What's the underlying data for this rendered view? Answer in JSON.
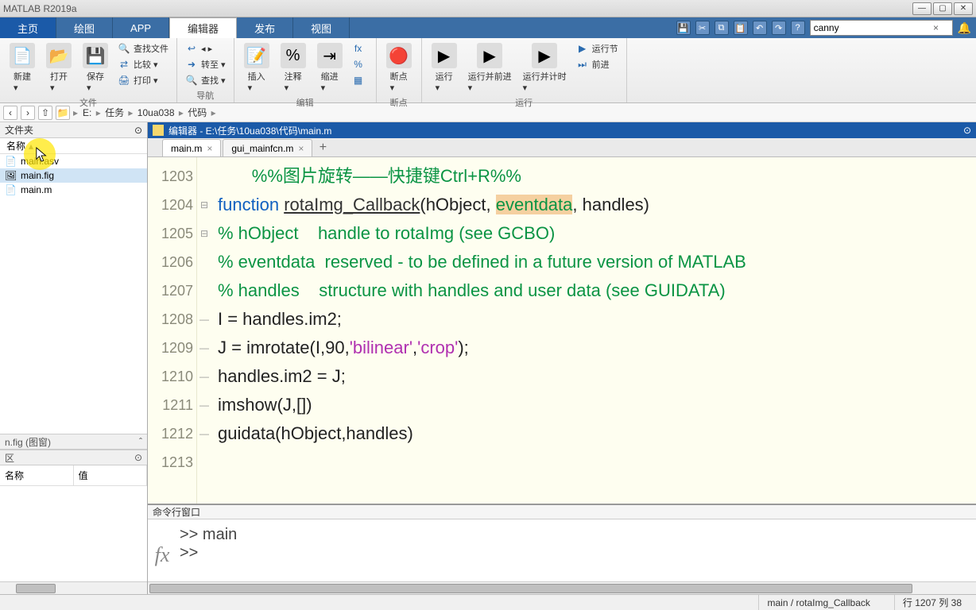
{
  "window": {
    "title": "MATLAB R2019a"
  },
  "tabs": {
    "items": [
      "主页",
      "绘图",
      "APP",
      "编辑器",
      "发布",
      "视图"
    ],
    "active_index": 3
  },
  "quick": {
    "search_value": "canny"
  },
  "ribbon": {
    "groups": [
      {
        "label": "文件",
        "big": [
          {
            "icon": "📄",
            "label": "新建"
          },
          {
            "icon": "📂",
            "label": "打开"
          },
          {
            "icon": "💾",
            "label": "保存"
          }
        ],
        "small": [
          {
            "icon": "🔍",
            "label": "查找文件"
          },
          {
            "icon": "⇄",
            "label": "比较 ▾"
          },
          {
            "icon": "🖨",
            "label": "打印 ▾"
          }
        ]
      },
      {
        "label": "导航",
        "big": [],
        "small": [
          {
            "icon": "↩",
            "label": "◂ ▸"
          },
          {
            "icon": "➜",
            "label": "转至 ▾"
          },
          {
            "icon": "🔍",
            "label": "查找 ▾"
          }
        ]
      },
      {
        "label": "编辑",
        "big": [
          {
            "icon": "📝",
            "label": "插入"
          },
          {
            "icon": "%",
            "label": "注释"
          },
          {
            "icon": "⇥",
            "label": "缩进"
          }
        ],
        "small": [
          {
            "icon": "fx",
            "label": ""
          },
          {
            "icon": "%",
            "label": ""
          },
          {
            "icon": "▦",
            "label": ""
          }
        ]
      },
      {
        "label": "断点",
        "big": [
          {
            "icon": "🔴",
            "label": "断点"
          }
        ],
        "small": []
      },
      {
        "label": "运行",
        "big": [
          {
            "icon": "▶",
            "label": "运行"
          },
          {
            "icon": "▶",
            "label": "运行并前进"
          },
          {
            "icon": "▶",
            "label": "运行并计时"
          }
        ],
        "small": [
          {
            "icon": "▶",
            "label": "运行节"
          },
          {
            "icon": "⏭",
            "label": "前进"
          }
        ]
      }
    ]
  },
  "path": {
    "segments": [
      "E:",
      "任务",
      "10ua038",
      "代码"
    ]
  },
  "folder": {
    "title": "文件夹",
    "colhdr": "名称",
    "files": [
      {
        "name": "main.asv",
        "icon": "📄"
      },
      {
        "name": "main.fig",
        "icon": "🖼",
        "selected": true
      },
      {
        "name": "main.m",
        "icon": "📄"
      }
    ]
  },
  "workspace": {
    "title": "n.fig (图窗)",
    "section": "区",
    "cols": [
      "名称",
      "值"
    ]
  },
  "editor": {
    "title": "编辑器 - E:\\任务\\10ua038\\代码\\main.m",
    "tabs": [
      {
        "name": "main.m",
        "active": true
      },
      {
        "name": "gui_mainfcn.m",
        "active": false
      }
    ],
    "lines": [
      {
        "num": "1203",
        "fold": "",
        "tokens": [
          {
            "t": "       ",
            "c": "text"
          },
          {
            "t": "%%图片旋转——快捷键Ctrl+R%%",
            "c": "comment"
          }
        ]
      },
      {
        "num": "1204",
        "fold": "⊟",
        "tokens": [
          {
            "t": "function",
            "c": "keyword"
          },
          {
            "t": " ",
            "c": "text"
          },
          {
            "t": "rotaImg_Callback",
            "c": "func"
          },
          {
            "t": "(hObject, ",
            "c": "text"
          },
          {
            "t": "eventdata",
            "c": "hlword"
          },
          {
            "t": ", handles)",
            "c": "text"
          }
        ]
      },
      {
        "num": "1205",
        "fold": "⊟",
        "tokens": [
          {
            "t": "% hObject    handle to rotaImg (see GCBO)",
            "c": "comment"
          }
        ]
      },
      {
        "num": "1206",
        "fold": "",
        "tokens": [
          {
            "t": "% eventdata  reserved - to be defined in a future version of MATLAB",
            "c": "comment"
          }
        ]
      },
      {
        "num": "1207",
        "fold": "",
        "tokens": [
          {
            "t": "% handles    structure with handles and user data (see GUIDATA)",
            "c": "comment"
          }
        ]
      },
      {
        "num": "1208",
        "fold": "—",
        "tokens": [
          {
            "t": "I = handles.im2;",
            "c": "text"
          }
        ]
      },
      {
        "num": "1209",
        "fold": "—",
        "tokens": [
          {
            "t": "J = imrotate(I,90,",
            "c": "text"
          },
          {
            "t": "'bilinear'",
            "c": "string"
          },
          {
            "t": ",",
            "c": "text"
          },
          {
            "t": "'crop'",
            "c": "string"
          },
          {
            "t": ");",
            "c": "text"
          }
        ]
      },
      {
        "num": "1210",
        "fold": "—",
        "tokens": [
          {
            "t": "handles.im2 = J;",
            "c": "text"
          }
        ]
      },
      {
        "num": "1211",
        "fold": "—",
        "tokens": [
          {
            "t": "imshow(J,[])",
            "c": "text"
          }
        ]
      },
      {
        "num": "1212",
        "fold": "—",
        "tokens": [
          {
            "t": "guidata(hObject,handles)",
            "c": "text"
          }
        ]
      },
      {
        "num": "1213",
        "fold": "",
        "tokens": [
          {
            "t": "",
            "c": "text"
          }
        ]
      }
    ]
  },
  "command": {
    "title": "命令行窗口",
    "history": [
      ">> main",
      ">> "
    ]
  },
  "status": {
    "context": "main / rotaImg_Callback",
    "line_label": "行",
    "line": "1207",
    "col_label": "列",
    "col": "38"
  }
}
